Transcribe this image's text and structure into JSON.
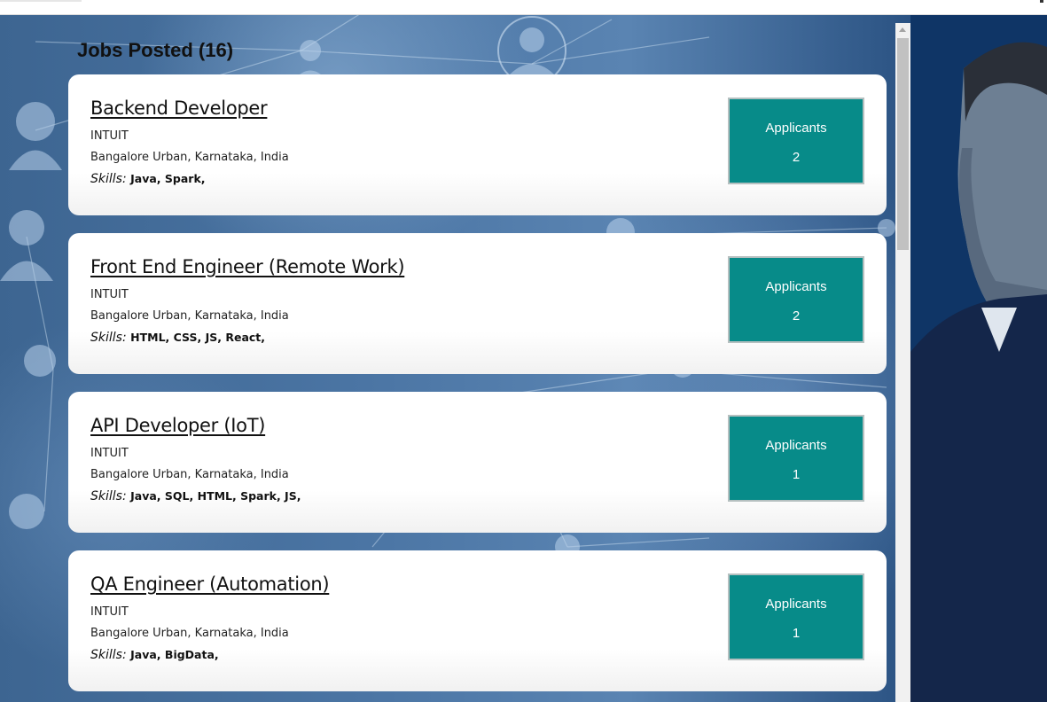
{
  "header": {
    "title": "Jobs Posted (16)"
  },
  "jobs": [
    {
      "title": "Backend Developer",
      "company": "INTUIT",
      "location": "Bangalore Urban, Karnataka, India",
      "skills_label": "Skills:",
      "skills": "Java,  Spark,",
      "applicants_label": "Applicants",
      "applicants_count": "2"
    },
    {
      "title": "Front End Engineer (Remote Work)",
      "company": "INTUIT",
      "location": "Bangalore Urban, Karnataka, India",
      "skills_label": "Skills:",
      "skills": "HTML,  CSS,  JS,  React,",
      "applicants_label": "Applicants",
      "applicants_count": "2"
    },
    {
      "title": "API Developer (IoT)",
      "company": "INTUIT",
      "location": "Bangalore Urban, Karnataka, India",
      "skills_label": "Skills:",
      "skills": "Java,  SQL,  HTML,  Spark,  JS,",
      "applicants_label": "Applicants",
      "applicants_count": "1"
    },
    {
      "title": "QA Engineer (Automation)",
      "company": "INTUIT",
      "location": "Bangalore Urban, Karnataka, India",
      "skills_label": "Skills:",
      "skills": "Java,  BigData,",
      "applicants_label": "Applicants",
      "applicants_count": "1"
    }
  ],
  "colors": {
    "applicants_button": "#078b89",
    "background_blue": "#3d6591"
  },
  "icons": {
    "background_network": "network-people-icon",
    "scroll_up": "arrow-up-icon"
  }
}
